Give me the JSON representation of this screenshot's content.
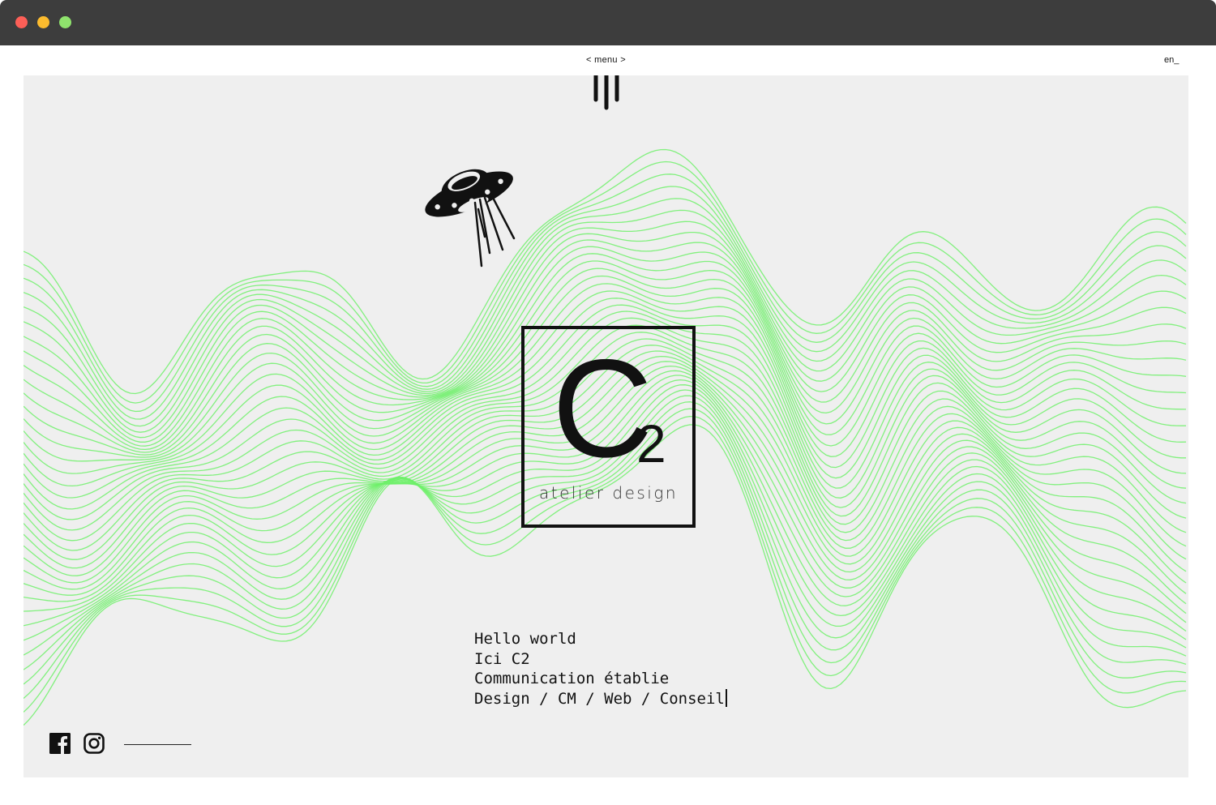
{
  "window": {
    "controls": [
      "close",
      "minimize",
      "zoom"
    ]
  },
  "nav": {
    "menu_label": "< menu >",
    "lang_label": "en_"
  },
  "brand": {
    "letter": "C",
    "subscript": "2",
    "tagline": "atelier design"
  },
  "intro": {
    "lines": [
      "Hello world",
      "Ici C2",
      "Communication établie",
      "Design / CM / Web / Conseil"
    ]
  },
  "social": {
    "items": [
      "facebook-icon",
      "instagram-icon"
    ]
  },
  "colors": {
    "wave": "#6ef06a",
    "background": "#efefef",
    "ink": "#111111",
    "titlebar": "#3d3d3d"
  },
  "icons": {
    "logo": "three-bars-logo-icon",
    "ufo": "ufo-icon"
  }
}
